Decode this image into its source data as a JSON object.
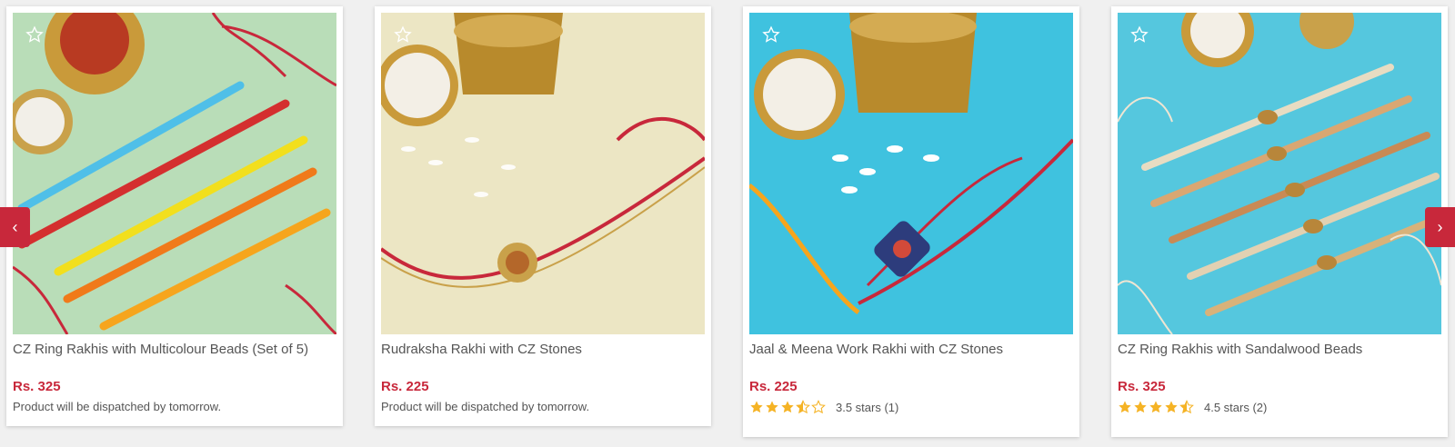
{
  "carousel": {
    "prev_icon": "‹",
    "next_icon": "›",
    "products": [
      {
        "title": "CZ Ring Rakhis with Multicolour Beads (Set of 5)",
        "price": "Rs. 325",
        "dispatch": "Product will be dispatched by tomorrow.",
        "background_color": "#b9ddb8"
      },
      {
        "title": "Rudraksha Rakhi with CZ Stones",
        "price": "Rs. 225",
        "dispatch": "Product will be dispatched by tomorrow.",
        "background_color": "#ece6c4"
      },
      {
        "title": "Jaal & Meena Work Rakhi with CZ Stones",
        "price": "Rs. 225",
        "rating_value": 3.5,
        "rating_text": "3.5 stars (1)",
        "background_color": "#3fc2df"
      },
      {
        "title": "CZ Ring Rakhis with Sandalwood Beads",
        "price": "Rs. 325",
        "rating_value": 4.5,
        "rating_text": "4.5 stars (2)",
        "background_color": "#55c7de"
      }
    ]
  },
  "colors": {
    "accent": "#c8283b",
    "star": "#f5b325",
    "star_empty": "#f5b325"
  }
}
